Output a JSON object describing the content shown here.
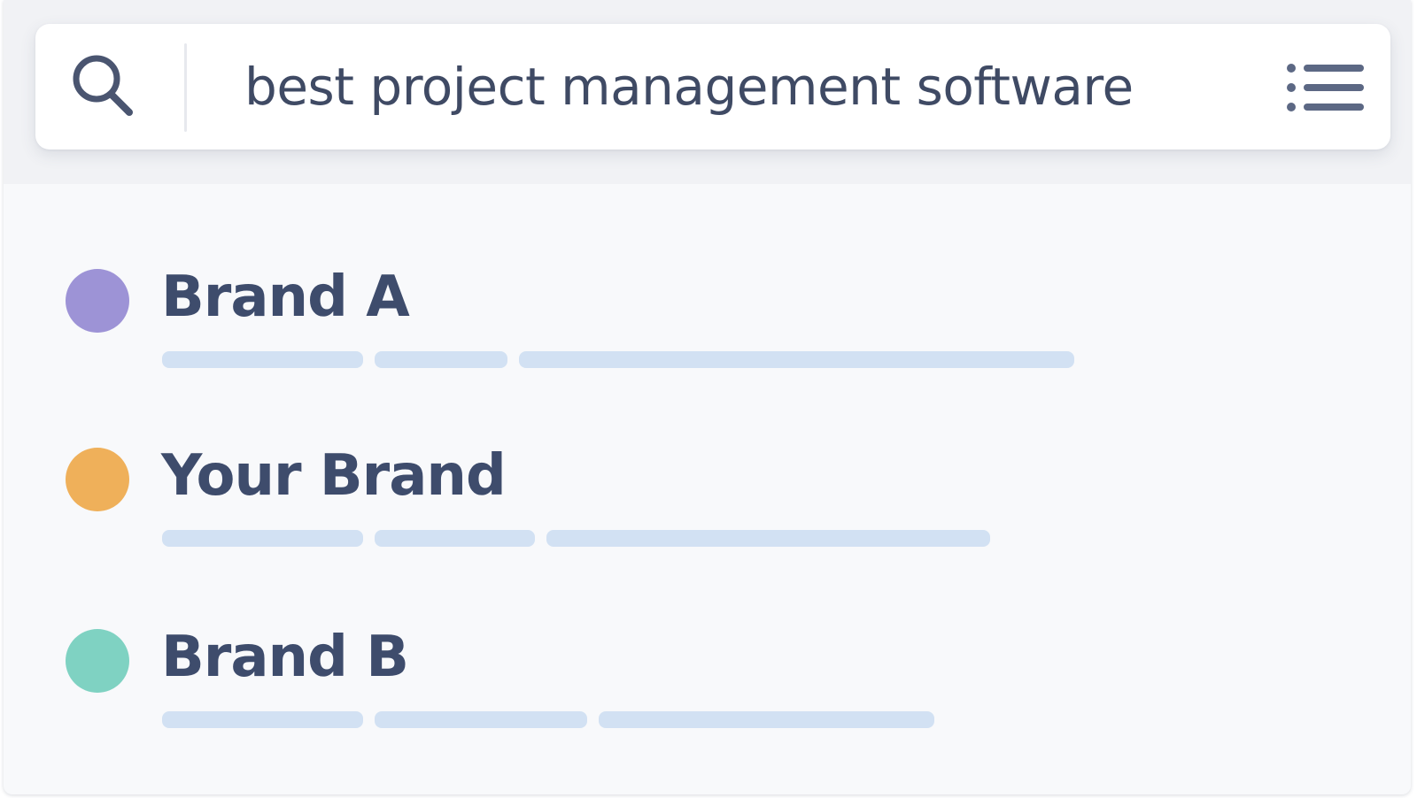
{
  "search": {
    "query": "best project management software",
    "icon": "search-icon",
    "menu_icon": "list-menu-icon"
  },
  "results": [
    {
      "title": "Brand A",
      "dot_color": "#9d93d6"
    },
    {
      "title": "Your Brand",
      "dot_color": "#efb05a"
    },
    {
      "title": "Brand B",
      "dot_color": "#7fd2c2"
    }
  ],
  "colors": {
    "text": "#3e4c6c",
    "skeleton": "#d2e1f3",
    "background": "#f8f9fb"
  }
}
